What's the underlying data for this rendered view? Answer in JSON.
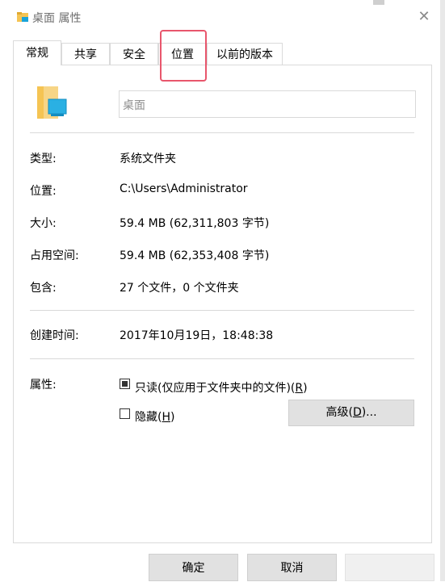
{
  "window": {
    "title": "桌面 属性",
    "icon": "folder-icon",
    "close_icon": "close-icon"
  },
  "tabs": [
    {
      "label": "常规",
      "active": true
    },
    {
      "label": "共享",
      "active": false
    },
    {
      "label": "安全",
      "active": false
    },
    {
      "label": "位置",
      "active": false,
      "highlighted": true
    },
    {
      "label": "以前的版本",
      "active": false
    }
  ],
  "general": {
    "name_value": "桌面",
    "rows": {
      "type": {
        "label": "类型:",
        "value": "系统文件夹"
      },
      "location": {
        "label": "位置:",
        "value": "C:\\Users\\Administrator"
      },
      "size": {
        "label": "大小:",
        "value": "59.4 MB (62,311,803 字节)"
      },
      "size_on_disk": {
        "label": "占用空间:",
        "value": "59.4 MB (62,353,408 字节)"
      },
      "contains": {
        "label": "包含:",
        "value": "27 个文件，0 个文件夹"
      },
      "created": {
        "label": "创建时间:",
        "value": "2017年10月19日，18:48:38"
      }
    },
    "attributes": {
      "label": "属性:",
      "readonly": {
        "text": "只读(仅应用于文件夹中的文件)(",
        "mnemonic": "R",
        "suffix": ")",
        "checked": true,
        "indeterminate": true
      },
      "hidden": {
        "text": "隐藏(",
        "mnemonic": "H",
        "suffix": ")",
        "checked": false
      },
      "advanced_button": {
        "text": "高级(",
        "mnemonic": "D",
        "suffix": ")..."
      }
    }
  },
  "footer": {
    "ok": "确定",
    "cancel": "取消",
    "apply": ""
  },
  "colors": {
    "highlight": "#e8566c",
    "folder": "#f5c453",
    "monitor": "#1aa3d9"
  }
}
